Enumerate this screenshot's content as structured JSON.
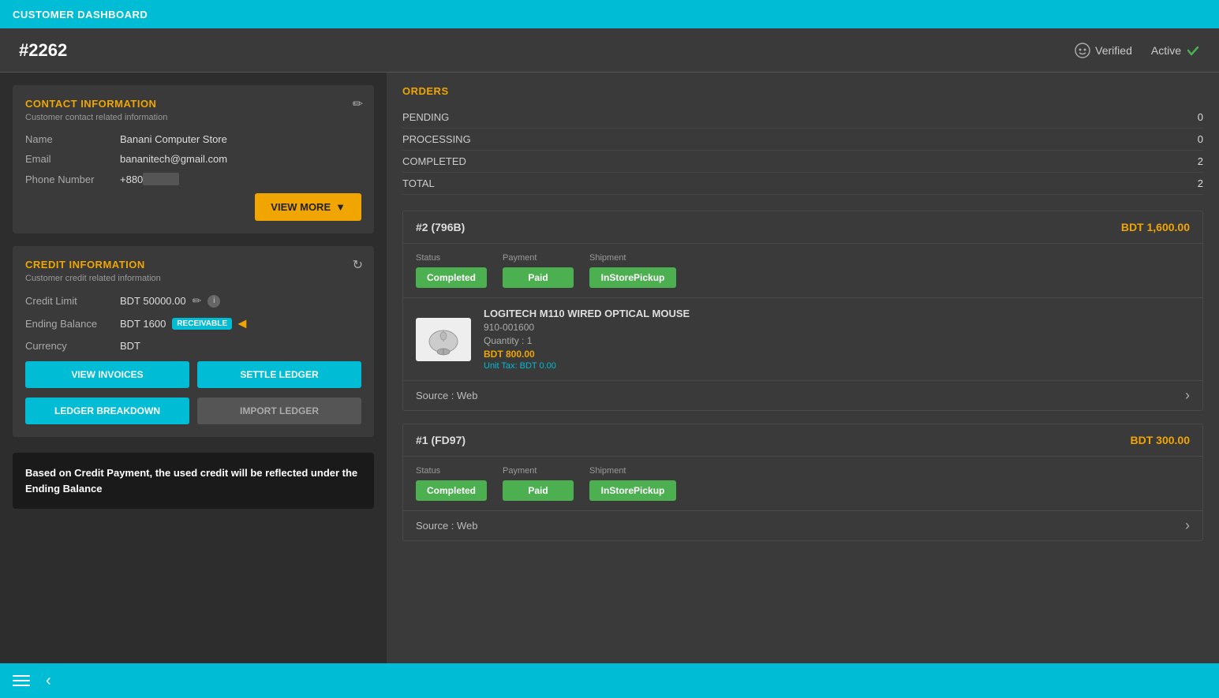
{
  "topBar": {
    "title": "CUSTOMER DASHBOARD"
  },
  "header": {
    "id": "#2262",
    "verified_label": "Verified",
    "active_label": "Active"
  },
  "contactInfo": {
    "section_title": "CONTACT INFORMATION",
    "section_subtitle": "Customer contact related information",
    "name_label": "Name",
    "name_value": "Banani Computer Store",
    "email_label": "Email",
    "email_value": "bananitech@gmail.com",
    "phone_label": "Phone Number",
    "phone_prefix": "+880",
    "view_more_btn": "VIEW MORE"
  },
  "creditInfo": {
    "section_title": "CREDIT INFORMATION",
    "section_subtitle": "Customer credit related information",
    "credit_limit_label": "Credit Limit",
    "credit_limit_value": "BDT 50000.00",
    "ending_balance_label": "Ending Balance",
    "ending_balance_value": "BDT 1600",
    "receivable_badge": "RECEIVABLE",
    "currency_label": "Currency",
    "currency_value": "BDT",
    "view_invoices_btn": "VIEW INVOICES",
    "settle_ledger_btn": "SETTLE LEDGER",
    "ledger_breakdown_btn": "LEDGER BREAKDOWN",
    "import_ledger_btn": "IMPORT LEDGER"
  },
  "tooltipBox": {
    "text": "Based on Credit Payment, the used credit will be reflected under the Ending Balance"
  },
  "orders": {
    "section_title": "ORDERS",
    "rows": [
      {
        "label": "PENDING",
        "value": "0"
      },
      {
        "label": "PROCESSING",
        "value": "0"
      },
      {
        "label": "COMPLETED",
        "value": "2"
      },
      {
        "label": "TOTAL",
        "value": "2"
      }
    ],
    "order1": {
      "id": "#2 (796B)",
      "amount": "BDT 1,600.00",
      "status_label": "Status",
      "payment_label": "Payment",
      "shipment_label": "Shipment",
      "status_value": "Completed",
      "payment_value": "Paid",
      "shipment_value": "InStorePickup",
      "source_label": "Source : Web",
      "product": {
        "name": "LOGITECH M110 WIRED OPTICAL MOUSE",
        "sku": "910-001600",
        "quantity": "Quantity : 1",
        "price": "BDT 800.00",
        "tax": "Unit Tax: BDT 0.00"
      }
    },
    "order2": {
      "id": "#1 (FD97)",
      "amount": "BDT 300.00",
      "status_label": "Status",
      "payment_label": "Payment",
      "shipment_label": "Shipment",
      "status_value": "Completed",
      "payment_value": "Paid",
      "shipment_value": "InStorePickup",
      "source_label": "Source : Web"
    }
  },
  "bottomBar": {
    "hamburger_label": "menu",
    "back_label": "back"
  }
}
